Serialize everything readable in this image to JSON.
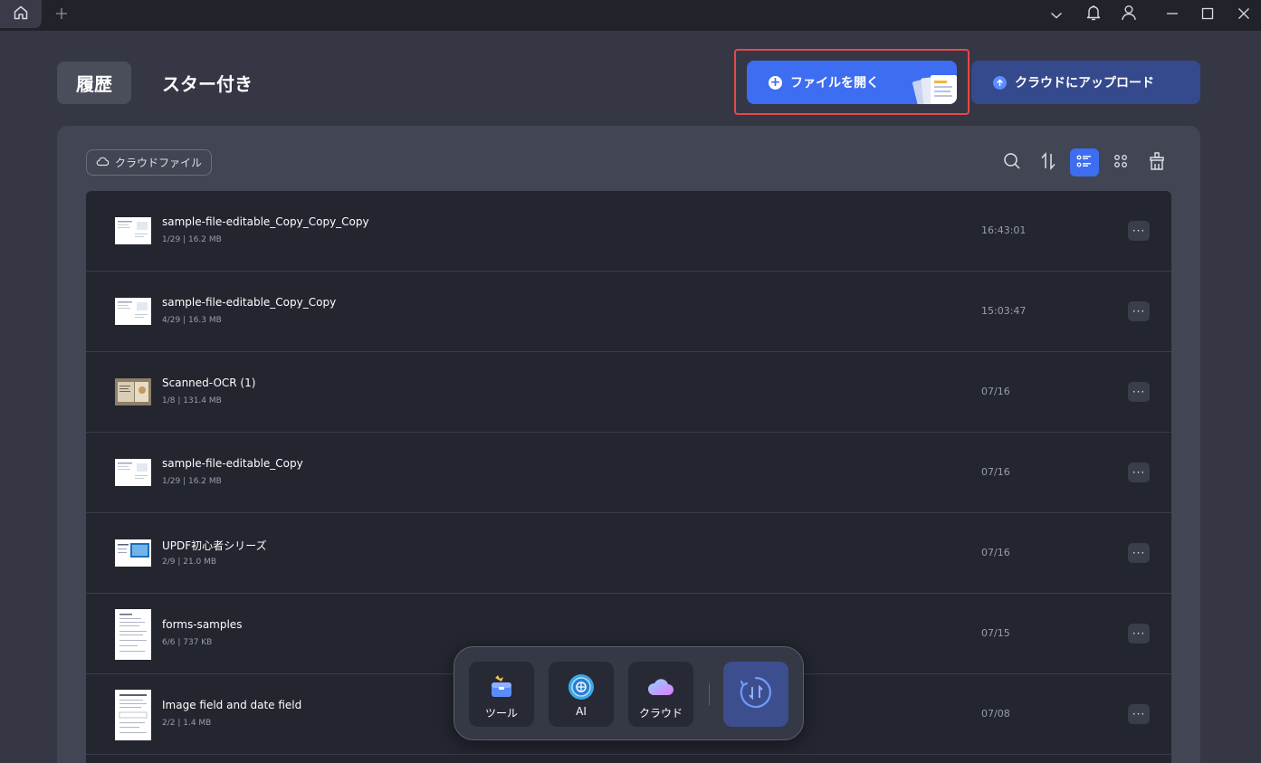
{
  "titlebar": {
    "icons": [
      "home-icon",
      "plus-icon",
      "chevron-down-icon",
      "bell-icon",
      "user-icon",
      "minimize-icon",
      "maximize-icon",
      "close-icon"
    ]
  },
  "tabs": {
    "history": "履歴",
    "starred": "スター付き"
  },
  "actions": {
    "open_file": "ファイルを開く",
    "upload_cloud": "クラウドにアップロード"
  },
  "toolbar": {
    "cloud_files": "クラウドファイル",
    "icons": [
      "search-icon",
      "sort-icon",
      "list-view-icon",
      "grid-view-icon",
      "clean-icon"
    ],
    "active_view": "list"
  },
  "files": [
    {
      "name": "sample-file-editable_Copy_Copy_Copy",
      "meta": "1/29 | 16.2 MB",
      "date": "16:43:01",
      "thumb": "landscape"
    },
    {
      "name": "sample-file-editable_Copy_Copy",
      "meta": "4/29 | 16.3 MB",
      "date": "15:03:47",
      "thumb": "landscape"
    },
    {
      "name": "Scanned-OCR (1)",
      "meta": "1/8 | 131.4 MB",
      "date": "07/16",
      "thumb": "landscape"
    },
    {
      "name": "sample-file-editable_Copy",
      "meta": "1/29 | 16.2 MB",
      "date": "07/16",
      "thumb": "landscape"
    },
    {
      "name": "UPDF初心者シリーズ",
      "meta": "2/9 | 21.0 MB",
      "date": "07/16",
      "thumb": "landscape"
    },
    {
      "name": "forms-samples",
      "meta": "6/6 | 737 KB",
      "date": "07/15",
      "thumb": "portrait"
    },
    {
      "name": "Image field and date field",
      "meta": "2/2 | 1.4 MB",
      "date": "07/08",
      "thumb": "portrait"
    }
  ],
  "more_label": "···",
  "dock": {
    "tools": "ツール",
    "ai": "AI",
    "cloud": "クラウド"
  },
  "colors": {
    "accent": "#3d6df1",
    "highlight": "#e5484d",
    "background": "#353844",
    "list_bg": "#23252f"
  }
}
